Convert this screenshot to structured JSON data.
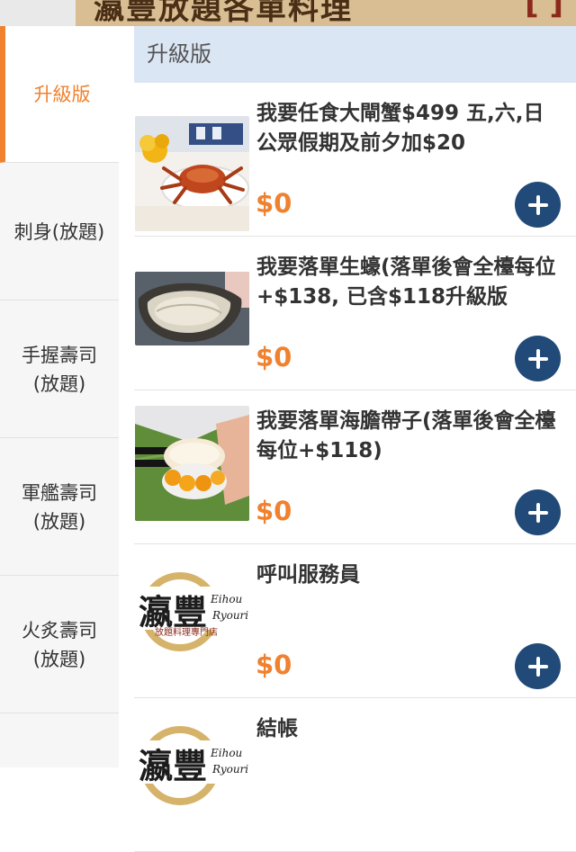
{
  "header": {
    "title": "瀛豐放題各單料理",
    "bracket": "[ ]"
  },
  "sidebar": {
    "items": [
      {
        "label": "升級版"
      },
      {
        "label": "刺身(放題)"
      },
      {
        "label": "手握壽司\n(放題)"
      },
      {
        "label": "軍艦壽司\n(放題)"
      },
      {
        "label": "火炙壽司\n(放題)"
      }
    ]
  },
  "section": {
    "title": "升級版"
  },
  "menu": {
    "items": [
      {
        "name": "我要任食大閘蟹$499 五,六,日公眾假期及前夕加$20",
        "price": "$0",
        "image": "crab-photo"
      },
      {
        "name": "我要落單生蠔(落單後會全檯每位+$138, 已含$118升級版",
        "price": "$0",
        "image": "oyster-photo"
      },
      {
        "name": "我要落單海膽帶子(落單後會全檯每位+$118)",
        "price": "$0",
        "image": "scallop-photo"
      },
      {
        "name": "呼叫服務員",
        "price": "$0",
        "image": "eihou-logo"
      },
      {
        "name": "結帳",
        "price": "",
        "image": "eihou-logo"
      }
    ]
  },
  "logo": {
    "brand": "瀛豐",
    "roman_1": "Eihou",
    "roman_2": "Ryouri",
    "subtitle": "放題料理專門店"
  },
  "colors": {
    "accent": "#f0812f",
    "add_button": "#214a78",
    "section_bg": "#dbe6f4",
    "header_bg": "#d9bd93"
  }
}
